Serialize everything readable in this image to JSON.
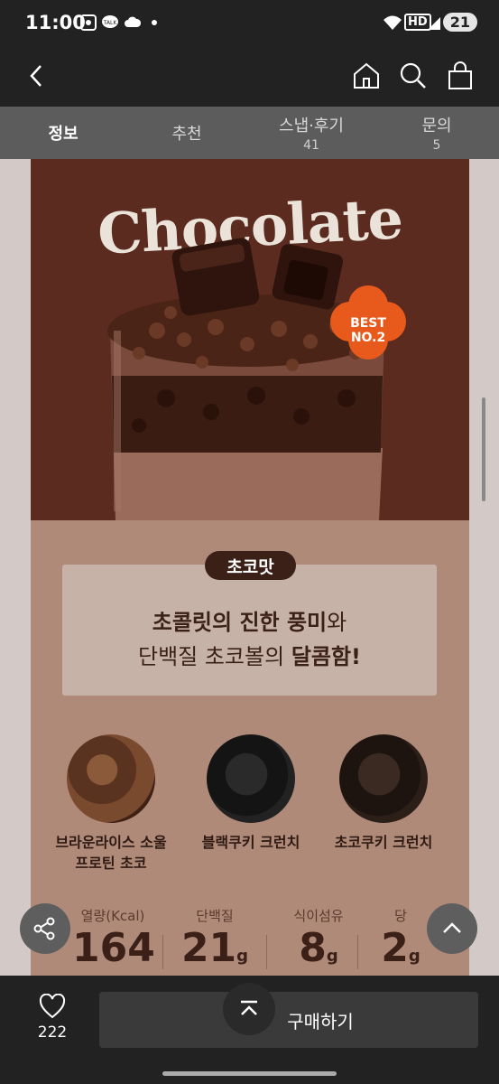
{
  "status_bar": {
    "time": "11:00",
    "battery": "21",
    "hd": "HD"
  },
  "tabs": [
    {
      "label": "정보",
      "count": ""
    },
    {
      "label": "추천",
      "count": ""
    },
    {
      "label": "스냅·후기",
      "count": "41"
    },
    {
      "label": "문의",
      "count": "5"
    }
  ],
  "hero": {
    "title": "Chocolate",
    "badge": "BEST NO.2"
  },
  "flavor": {
    "pill": "초코맛",
    "line1_bold": "초콜릿의 진한 풍미",
    "line1_rest": "와",
    "line2_prefix": "단백질 초코볼의 ",
    "line2_bold": "달콤함!"
  },
  "ingredients": [
    {
      "name_line1": "브라운라이스 소울",
      "name_line2": "프로틴 초코"
    },
    {
      "name_line1": "블랙쿠키 크런치",
      "name_line2": ""
    },
    {
      "name_line1": "초코쿠키 크런치",
      "name_line2": ""
    }
  ],
  "nutrition": [
    {
      "label": "열량(Kcal)",
      "value": "164",
      "unit": ""
    },
    {
      "label": "단백질",
      "value": "21",
      "unit": "g"
    },
    {
      "label": "식이섬유",
      "value": "8",
      "unit": "g"
    },
    {
      "label": "당",
      "value": "2",
      "unit": "g"
    }
  ],
  "bottom": {
    "like_count": "222",
    "buy_label": "구매하기"
  },
  "colors": {
    "hero_bg": "#5a2b1e",
    "detail_bg": "#b08a79",
    "badge": "#e85a1c"
  }
}
